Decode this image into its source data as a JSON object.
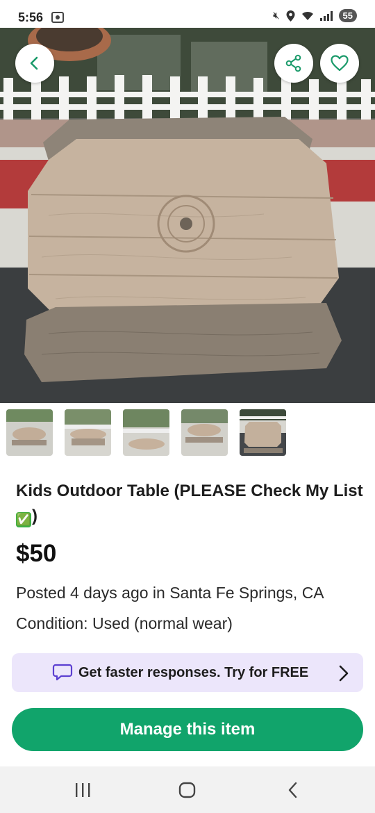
{
  "status_bar": {
    "time": "5:56",
    "battery": "55",
    "icons": [
      "screenshot-icon",
      "mute-icon",
      "location-icon",
      "wifi-icon",
      "signal-icon",
      "battery-icon"
    ]
  },
  "header": {
    "back_icon": "chevron-left-icon",
    "share_icon": "share-icon",
    "favorite_icon": "heart-icon"
  },
  "gallery": {
    "thumbnail_count": 5,
    "active_index": 4
  },
  "listing": {
    "title": "Kids Outdoor Table (PLEASE Check My List",
    "title_tail": ")",
    "title_emoji": "✅",
    "price": "$50",
    "posted": "Posted 4 days ago in Santa Fe Springs, CA",
    "condition": "Condition: Used (normal wear)"
  },
  "promo": {
    "icon": "chat-bubble-icon",
    "text": "Get faster responses. Try for FREE",
    "accent": "#5b3fd1",
    "background": "#ece6fb"
  },
  "actions": {
    "manage_label": "Manage this item",
    "manage_color": "#11a46b"
  },
  "nav": {
    "icons": [
      "recent-apps-icon",
      "home-icon",
      "back-nav-icon"
    ]
  }
}
